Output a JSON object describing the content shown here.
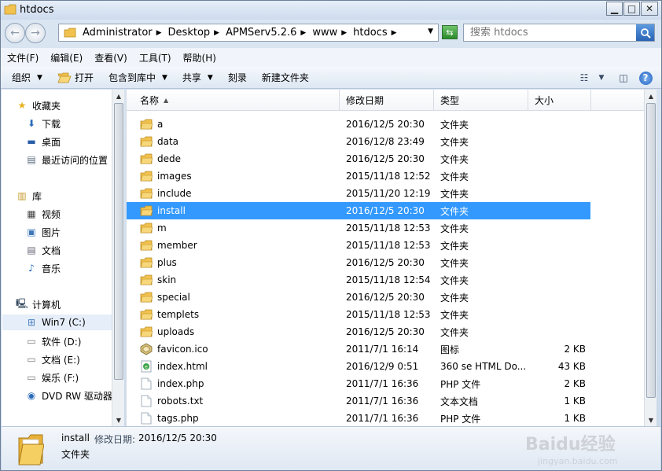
{
  "window": {
    "title": "htdocs"
  },
  "address": {
    "crumbs": [
      "Administrator",
      "Desktop",
      "APMServ5.2.6",
      "www",
      "htdocs"
    ]
  },
  "search": {
    "placeholder": "搜索 htdocs"
  },
  "menu": [
    "文件(F)",
    "编辑(E)",
    "查看(V)",
    "工具(T)",
    "帮助(H)"
  ],
  "toolbar": {
    "organize": "组织",
    "open": "打开",
    "include_in_library": "包含到库中",
    "share": "共享",
    "burn": "刻录",
    "new_folder": "新建文件夹"
  },
  "nav": {
    "favorites": "收藏夹",
    "downloads": "下载",
    "desktop": "桌面",
    "recent": "最近访问的位置",
    "libraries": "库",
    "videos": "视频",
    "pictures": "图片",
    "documents": "文档",
    "music": "音乐",
    "computer": "计算机",
    "drive_c": "Win7 (C:)",
    "drive_d": "软件 (D:)",
    "drive_e": "文档 (E:)",
    "drive_f": "娱乐 (F:)",
    "dvd": "DVD RW 驱动器"
  },
  "columns": {
    "name": "名称",
    "date": "修改日期",
    "type": "类型",
    "size": "大小"
  },
  "files": [
    {
      "name": "a",
      "date": "2016/12/5 20:30",
      "type": "文件夹",
      "size": "",
      "icon": "folder"
    },
    {
      "name": "data",
      "date": "2016/12/8 23:49",
      "type": "文件夹",
      "size": "",
      "icon": "folder"
    },
    {
      "name": "dede",
      "date": "2016/12/5 20:30",
      "type": "文件夹",
      "size": "",
      "icon": "folder"
    },
    {
      "name": "images",
      "date": "2015/11/18 12:52",
      "type": "文件夹",
      "size": "",
      "icon": "folder"
    },
    {
      "name": "include",
      "date": "2015/11/20 12:19",
      "type": "文件夹",
      "size": "",
      "icon": "folder"
    },
    {
      "name": "install",
      "date": "2016/12/5 20:30",
      "type": "文件夹",
      "size": "",
      "icon": "folder",
      "selected": true
    },
    {
      "name": "m",
      "date": "2015/11/18 12:53",
      "type": "文件夹",
      "size": "",
      "icon": "folder"
    },
    {
      "name": "member",
      "date": "2015/11/18 12:53",
      "type": "文件夹",
      "size": "",
      "icon": "folder"
    },
    {
      "name": "plus",
      "date": "2016/12/5 20:30",
      "type": "文件夹",
      "size": "",
      "icon": "folder"
    },
    {
      "name": "skin",
      "date": "2015/11/18 12:54",
      "type": "文件夹",
      "size": "",
      "icon": "folder"
    },
    {
      "name": "special",
      "date": "2016/12/5 20:30",
      "type": "文件夹",
      "size": "",
      "icon": "folder"
    },
    {
      "name": "templets",
      "date": "2015/11/18 12:53",
      "type": "文件夹",
      "size": "",
      "icon": "folder"
    },
    {
      "name": "uploads",
      "date": "2016/12/5 20:30",
      "type": "文件夹",
      "size": "",
      "icon": "folder"
    },
    {
      "name": "favicon.ico",
      "date": "2011/7/1 16:14",
      "type": "图标",
      "size": "2 KB",
      "icon": "ico"
    },
    {
      "name": "index.html",
      "date": "2016/12/9 0:51",
      "type": "360 se HTML Do...",
      "size": "43 KB",
      "icon": "html"
    },
    {
      "name": "index.php",
      "date": "2011/7/1 16:36",
      "type": "PHP 文件",
      "size": "2 KB",
      "icon": "file"
    },
    {
      "name": "robots.txt",
      "date": "2011/7/1 16:36",
      "type": "文本文档",
      "size": "1 KB",
      "icon": "file"
    },
    {
      "name": "tags.php",
      "date": "2011/7/1 16:36",
      "type": "PHP 文件",
      "size": "1 KB",
      "icon": "file"
    }
  ],
  "details": {
    "name": "install",
    "date_label": "修改日期:",
    "date": "2016/12/5 20:30",
    "type": "文件夹"
  },
  "watermark": {
    "line1": "Baidu经验",
    "line2": "jingyan.baidu.com"
  },
  "colors": {
    "selection": "#3399ff",
    "folder": "#f2c24f",
    "chrome": "#dbe6f2"
  }
}
